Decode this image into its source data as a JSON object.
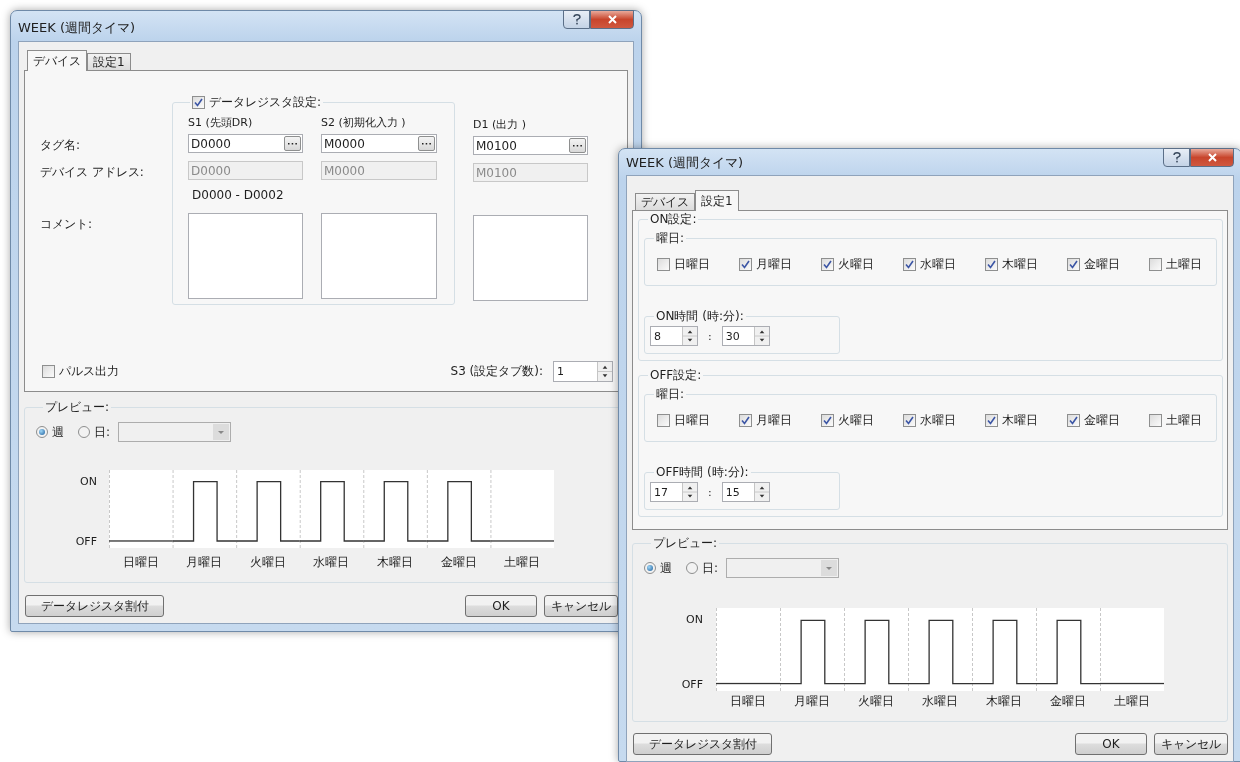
{
  "main_window": {
    "title": "WEEK (週間タイマ)",
    "tabs": [
      {
        "label": "デバイス",
        "selected": true
      },
      {
        "label": "設定1",
        "selected": false
      }
    ],
    "device_panel": {
      "register_setting": {
        "label": "データレジスタ設定:",
        "checked": true
      },
      "row_labels": [
        "タグ名:",
        "デバイス アドレス:",
        "コメント:"
      ],
      "register_columns": [
        {
          "header": "S1 (先頭DR)",
          "tag": "D0000",
          "address": "D0000",
          "address_disabled": true,
          "range": "D0000 - D0002"
        },
        {
          "header": "S2 (初期化入力 )",
          "tag": "M0000",
          "address": "M0000",
          "address_disabled": true
        }
      ],
      "output_column": {
        "header": "D1 (出力 )",
        "tag": "M0100",
        "address": "M0100",
        "address_disabled": true
      },
      "pulse_output": {
        "label": "パルス出力",
        "checked": false
      },
      "tab_count": {
        "label": "S3 (設定タブ数):",
        "value": "1"
      }
    },
    "preview": {
      "label": "プレビュー:",
      "modes": [
        {
          "label": "週",
          "selected": true
        },
        {
          "label": "日:",
          "selected": false
        }
      ],
      "day_select": {
        "disabled": true
      },
      "on_label": "ON",
      "off_label": "OFF",
      "days": [
        {
          "label": "日曜日",
          "pulse": false
        },
        {
          "label": "月曜日",
          "pulse": true
        },
        {
          "label": "火曜日",
          "pulse": true
        },
        {
          "label": "水曜日",
          "pulse": true
        },
        {
          "label": "木曜日",
          "pulse": true
        },
        {
          "label": "金曜日",
          "pulse": true
        },
        {
          "label": "土曜日",
          "pulse": false
        }
      ]
    },
    "buttons": [
      {
        "label": "データレジスタ割付",
        "kind": "assign"
      },
      {
        "label": "OK",
        "kind": "ok"
      },
      {
        "label": "キャンセル",
        "kind": "cancel"
      }
    ]
  },
  "front_window": {
    "title": "WEEK (週間タイマ)",
    "tabs": [
      {
        "label": "デバイス",
        "selected": false
      },
      {
        "label": "設定1",
        "selected": true
      }
    ],
    "settings_panel": {
      "groups": [
        {
          "label": "ON設定:",
          "weekday_label": "曜日:",
          "days": [
            {
              "label": "日曜日",
              "checked": false
            },
            {
              "label": "月曜日",
              "checked": true
            },
            {
              "label": "火曜日",
              "checked": true
            },
            {
              "label": "水曜日",
              "checked": true
            },
            {
              "label": "木曜日",
              "checked": true
            },
            {
              "label": "金曜日",
              "checked": true
            },
            {
              "label": "土曜日",
              "checked": false
            }
          ],
          "time": {
            "label": "ON時間 (時:分):",
            "hour": "8",
            "separator": ":",
            "minute": "30"
          }
        },
        {
          "label": "OFF設定:",
          "weekday_label": "曜日:",
          "days": [
            {
              "label": "日曜日",
              "checked": false
            },
            {
              "label": "月曜日",
              "checked": true
            },
            {
              "label": "火曜日",
              "checked": true
            },
            {
              "label": "水曜日",
              "checked": true
            },
            {
              "label": "木曜日",
              "checked": true
            },
            {
              "label": "金曜日",
              "checked": true
            },
            {
              "label": "土曜日",
              "checked": false
            }
          ],
          "time": {
            "label": "OFF時間 (時:分):",
            "hour": "17",
            "separator": ":",
            "minute": "15"
          }
        }
      ]
    },
    "preview": {
      "label": "プレビュー:",
      "modes": [
        {
          "label": "週",
          "selected": true
        },
        {
          "label": "日:",
          "selected": false
        }
      ],
      "day_select": {
        "disabled": true
      },
      "on_label": "ON",
      "off_label": "OFF",
      "days": [
        {
          "label": "日曜日",
          "pulse": false
        },
        {
          "label": "月曜日",
          "pulse": true
        },
        {
          "label": "火曜日",
          "pulse": true
        },
        {
          "label": "水曜日",
          "pulse": true
        },
        {
          "label": "木曜日",
          "pulse": true
        },
        {
          "label": "金曜日",
          "pulse": true
        },
        {
          "label": "土曜日",
          "pulse": false
        }
      ]
    },
    "buttons": [
      {
        "label": "データレジスタ割付",
        "kind": "assign"
      },
      {
        "label": "OK",
        "kind": "ok"
      },
      {
        "label": "キャンセル",
        "kind": "cancel"
      }
    ]
  }
}
